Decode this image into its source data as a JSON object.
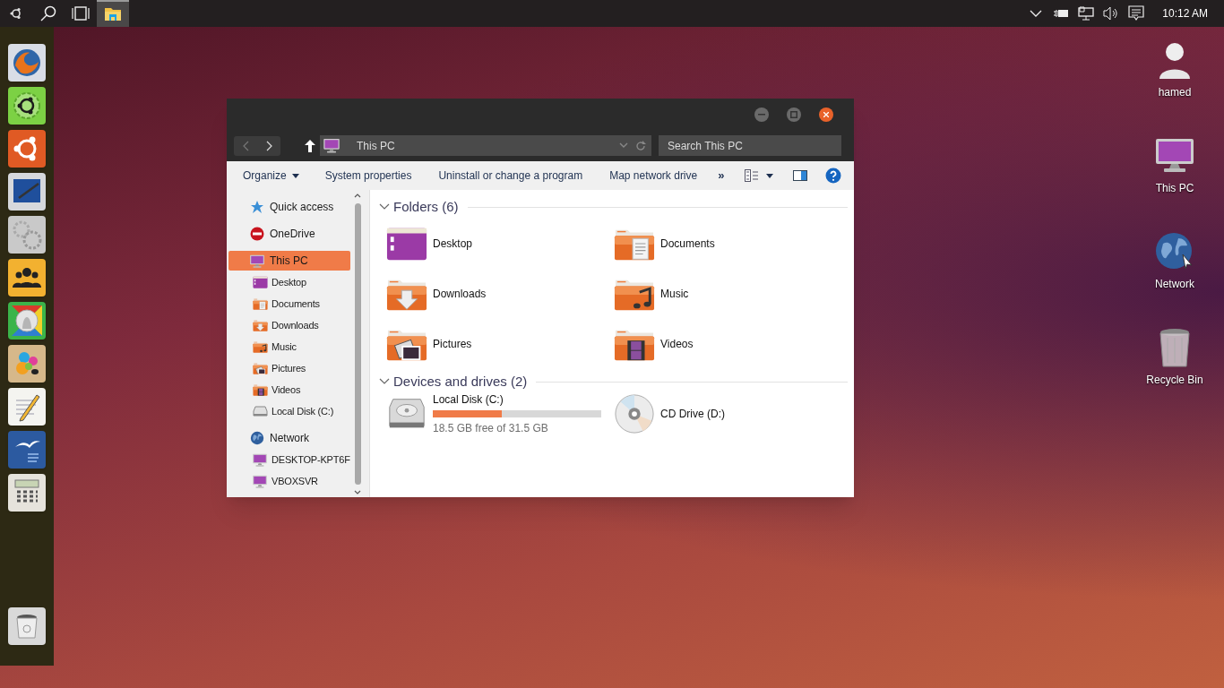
{
  "taskbar": {
    "apps": [
      {
        "kind": "explorer",
        "selected": true
      }
    ],
    "clock": "10:12 AM"
  },
  "desktop_icons": [
    {
      "kind": "user",
      "label": "hamed"
    },
    {
      "kind": "pc",
      "label": "This PC"
    },
    {
      "kind": "network",
      "label": "Network"
    },
    {
      "kind": "bin",
      "label": "Recycle Bin"
    }
  ],
  "explorer": {
    "address": "This PC",
    "search": {
      "placeholder": "Search This PC"
    },
    "toolbar": [
      {
        "kind": "menu",
        "label": "Organize"
      },
      {
        "kind": "button",
        "label": "System properties"
      },
      {
        "kind": "button",
        "label": "Uninstall or change a program"
      },
      {
        "kind": "button",
        "label": "Map network drive"
      },
      {
        "kind": "more",
        "label": "»"
      }
    ],
    "nav": [
      {
        "kind": "star",
        "label": "Quick access",
        "selected": false
      },
      {
        "kind": "onedrive",
        "label": "OneDrive",
        "selected": false
      },
      {
        "kind": "pc",
        "label": "This PC",
        "selected": true,
        "children": [
          {
            "kind": "desktop",
            "label": "Desktop",
            "selected": false
          },
          {
            "kind": "documents",
            "label": "Documents",
            "selected": false
          },
          {
            "kind": "downloads",
            "label": "Downloads",
            "selected": false
          },
          {
            "kind": "music",
            "label": "Music",
            "selected": false
          },
          {
            "kind": "pictures",
            "label": "Pictures",
            "selected": false
          },
          {
            "kind": "videos",
            "label": "Videos",
            "selected": false
          },
          {
            "kind": "disk",
            "label": "Local Disk (C:)",
            "selected": false
          }
        ]
      },
      {
        "kind": "network",
        "label": "Network",
        "selected": false,
        "children": [
          {
            "kind": "pc",
            "label": "DESKTOP-KPT6F",
            "selected": false
          },
          {
            "kind": "pc",
            "label": "VBOXSVR",
            "selected": false
          }
        ]
      }
    ],
    "sections": [
      {
        "title": "Folders (6)",
        "items": [
          {
            "kind": "desktop",
            "label": "Desktop"
          },
          {
            "kind": "documents",
            "label": "Documents"
          },
          {
            "kind": "downloads",
            "label": "Downloads"
          },
          {
            "kind": "music",
            "label": "Music"
          },
          {
            "kind": "pictures",
            "label": "Pictures"
          },
          {
            "kind": "videos",
            "label": "Videos"
          }
        ]
      },
      {
        "title": "Devices and drives (2)",
        "items": [
          {
            "kind": "disk",
            "label": "Local Disk (C:)",
            "level": 0.41,
            "free": "18.5 GB free of 31.5 GB"
          },
          {
            "kind": "cd",
            "label": "CD Drive (D:)"
          }
        ]
      }
    ]
  }
}
